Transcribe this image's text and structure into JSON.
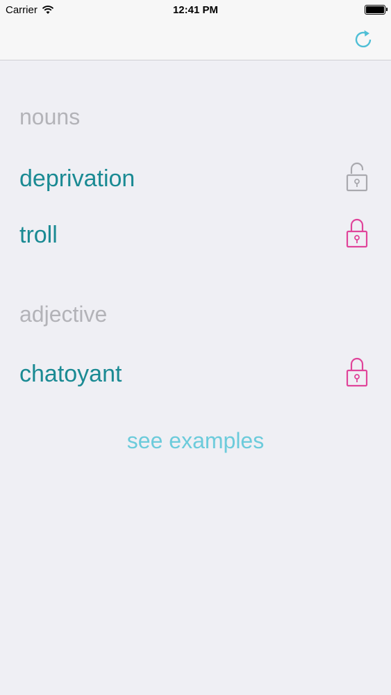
{
  "status_bar": {
    "carrier": "Carrier",
    "time": "12:41 PM"
  },
  "nav": {
    "refresh_icon": "refresh-icon"
  },
  "sections": [
    {
      "header": "nouns",
      "items": [
        {
          "word": "deprivation",
          "locked": false,
          "lock_color": "#a9a9ae"
        },
        {
          "word": "troll",
          "locked": true,
          "lock_color": "#e0449a"
        }
      ]
    },
    {
      "header": "adjective",
      "items": [
        {
          "word": "chatoyant",
          "locked": true,
          "lock_color": "#e0449a"
        }
      ]
    }
  ],
  "see_examples": "see examples",
  "colors": {
    "word": "#1a8a93",
    "header": "#b3b3b8",
    "link": "#6ccbdb",
    "background": "#efeff4"
  }
}
